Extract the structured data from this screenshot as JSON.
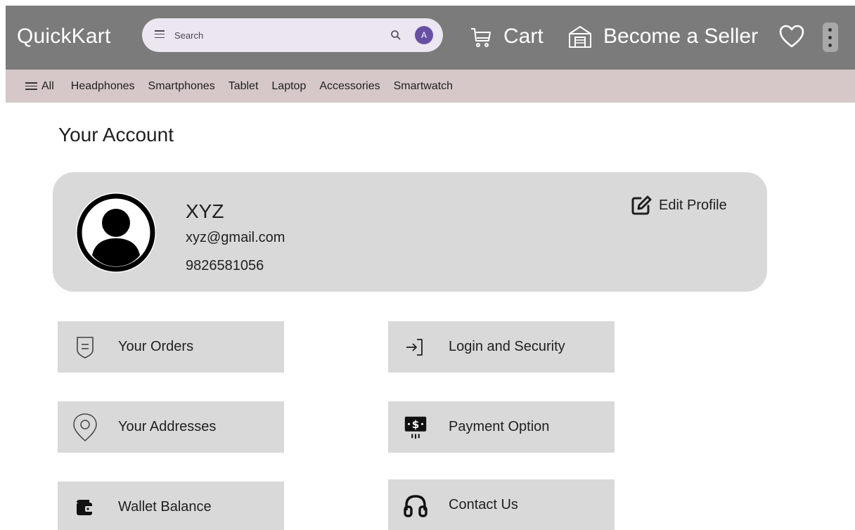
{
  "header": {
    "logo": "QuickKart",
    "search_placeholder": "Search",
    "avatar_initial": "A",
    "cart_label": "Cart",
    "seller_label": "Become a Seller"
  },
  "categories": {
    "all_label": "All",
    "items": [
      "Headphones",
      "Smartphones",
      "Tablet",
      "Laptop",
      "Accessories",
      "Smartwatch"
    ]
  },
  "page": {
    "title": "Your Account"
  },
  "profile": {
    "name": "XYZ",
    "email": "xyz@gmail.com",
    "phone": "9826581056",
    "edit_label": "Edit Profile"
  },
  "tiles": [
    {
      "label": "Your Orders",
      "icon": "orders-icon"
    },
    {
      "label": "Login and Security",
      "icon": "login-icon"
    },
    {
      "label": "Your Addresses",
      "icon": "location-icon"
    },
    {
      "label": "Payment Option",
      "icon": "payment-icon"
    },
    {
      "label": "Wallet Balance",
      "icon": "wallet-icon"
    },
    {
      "label": "Contact Us",
      "icon": "headphones-icon"
    }
  ],
  "colors": {
    "header_bg": "#7b7b7b",
    "category_bar_bg": "#d6c8c8",
    "card_bg": "#d9d9d9",
    "avatar_accent": "#6750a4"
  }
}
